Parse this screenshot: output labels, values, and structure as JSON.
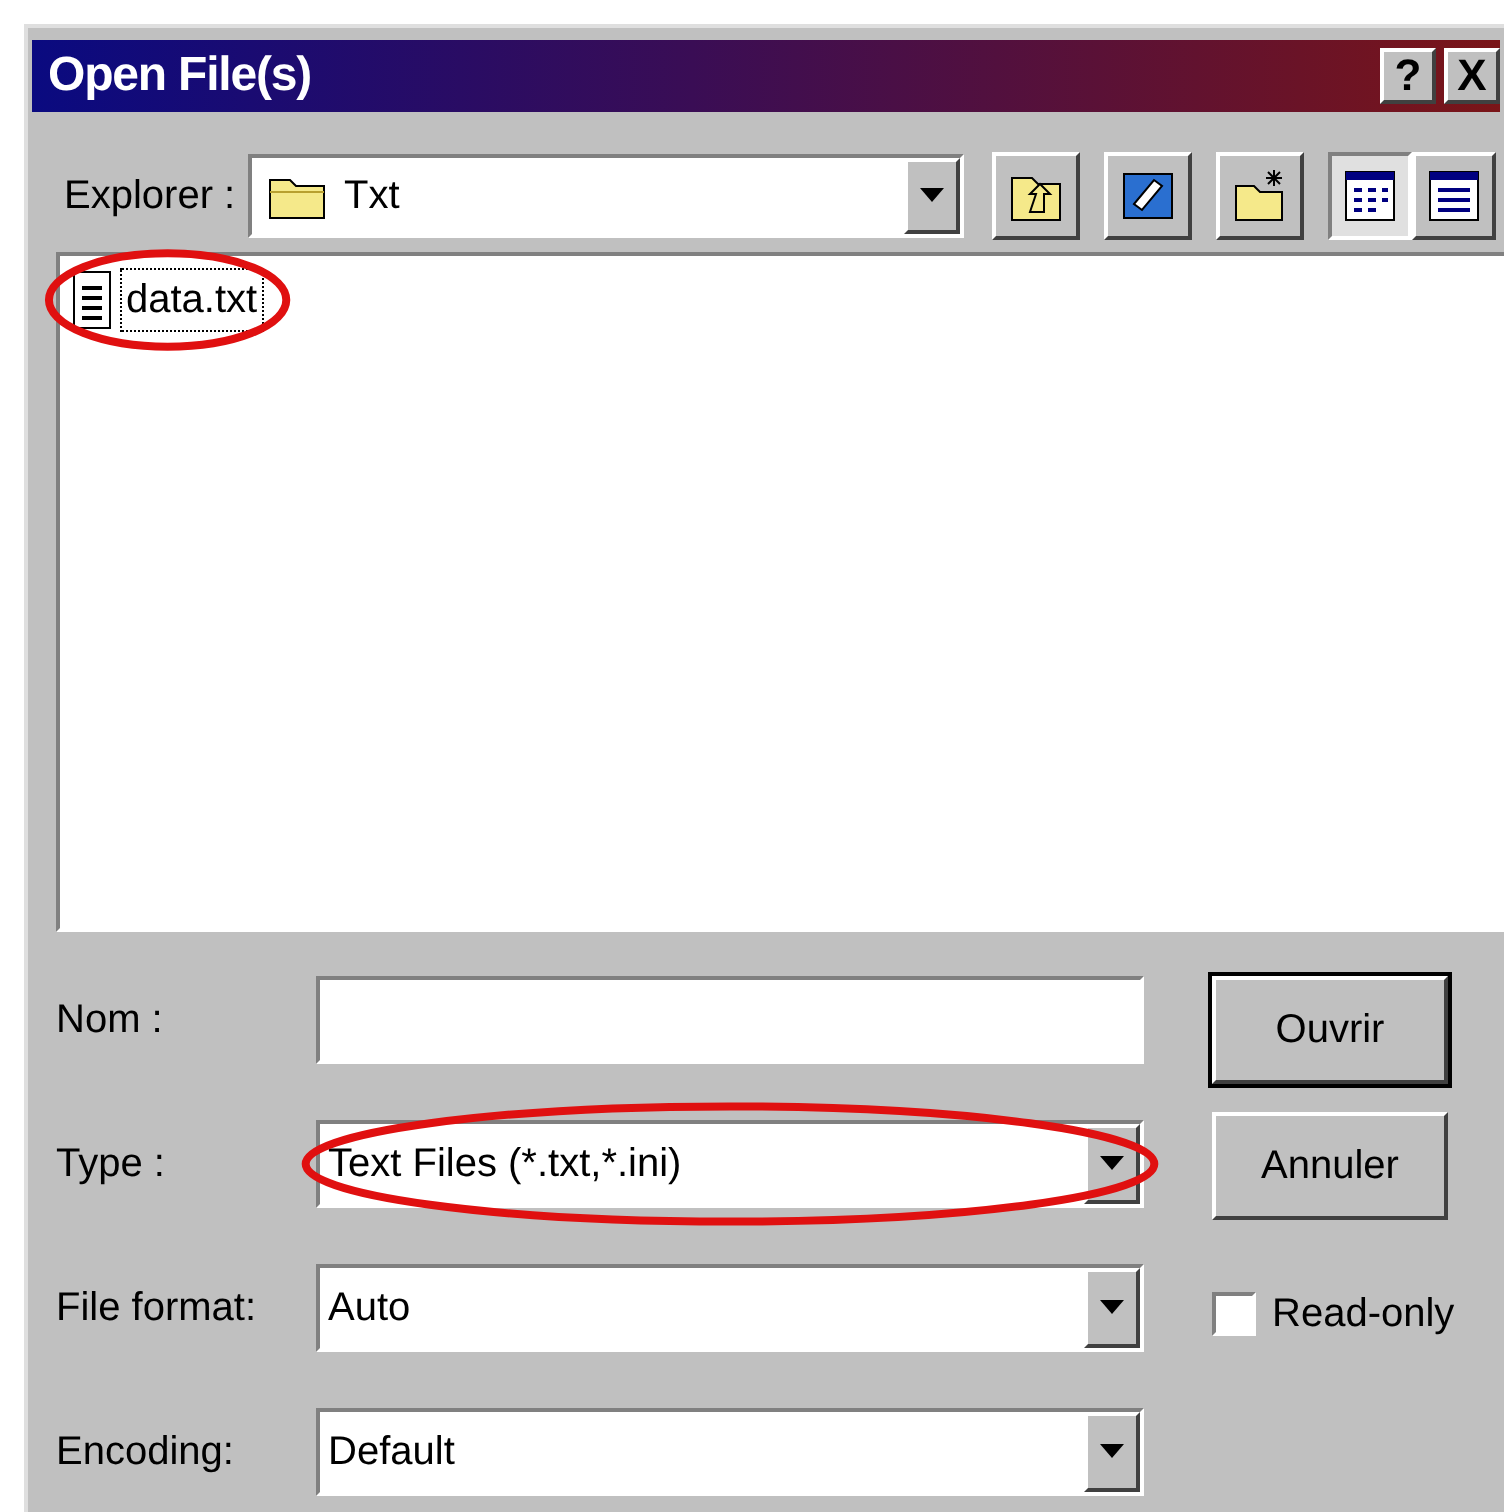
{
  "window": {
    "title": "Open File(s)",
    "title_buttons": [
      "?",
      "X"
    ]
  },
  "explorer": {
    "label": "Explorer :",
    "value": "Txt"
  },
  "files": [
    {
      "name": "data.txt",
      "selected": true,
      "annotated": true
    }
  ],
  "fields": [
    {
      "kind": "text",
      "label": "Nom :",
      "annotated": false
    },
    {
      "kind": "dropdown",
      "label": "Type :",
      "value": "Text Files (*.txt,*.ini)",
      "annotated": true
    },
    {
      "kind": "dropdown",
      "label": "File format:",
      "value": "Auto",
      "annotated": false
    },
    {
      "kind": "dropdown",
      "label": "Encoding:",
      "value": "Default",
      "annotated": false
    }
  ],
  "buttons": [
    {
      "label": "Ouvrir",
      "default": true
    },
    {
      "label": "Annuler",
      "default": false
    }
  ],
  "read_only": {
    "label": "Read-only",
    "checked": false
  }
}
